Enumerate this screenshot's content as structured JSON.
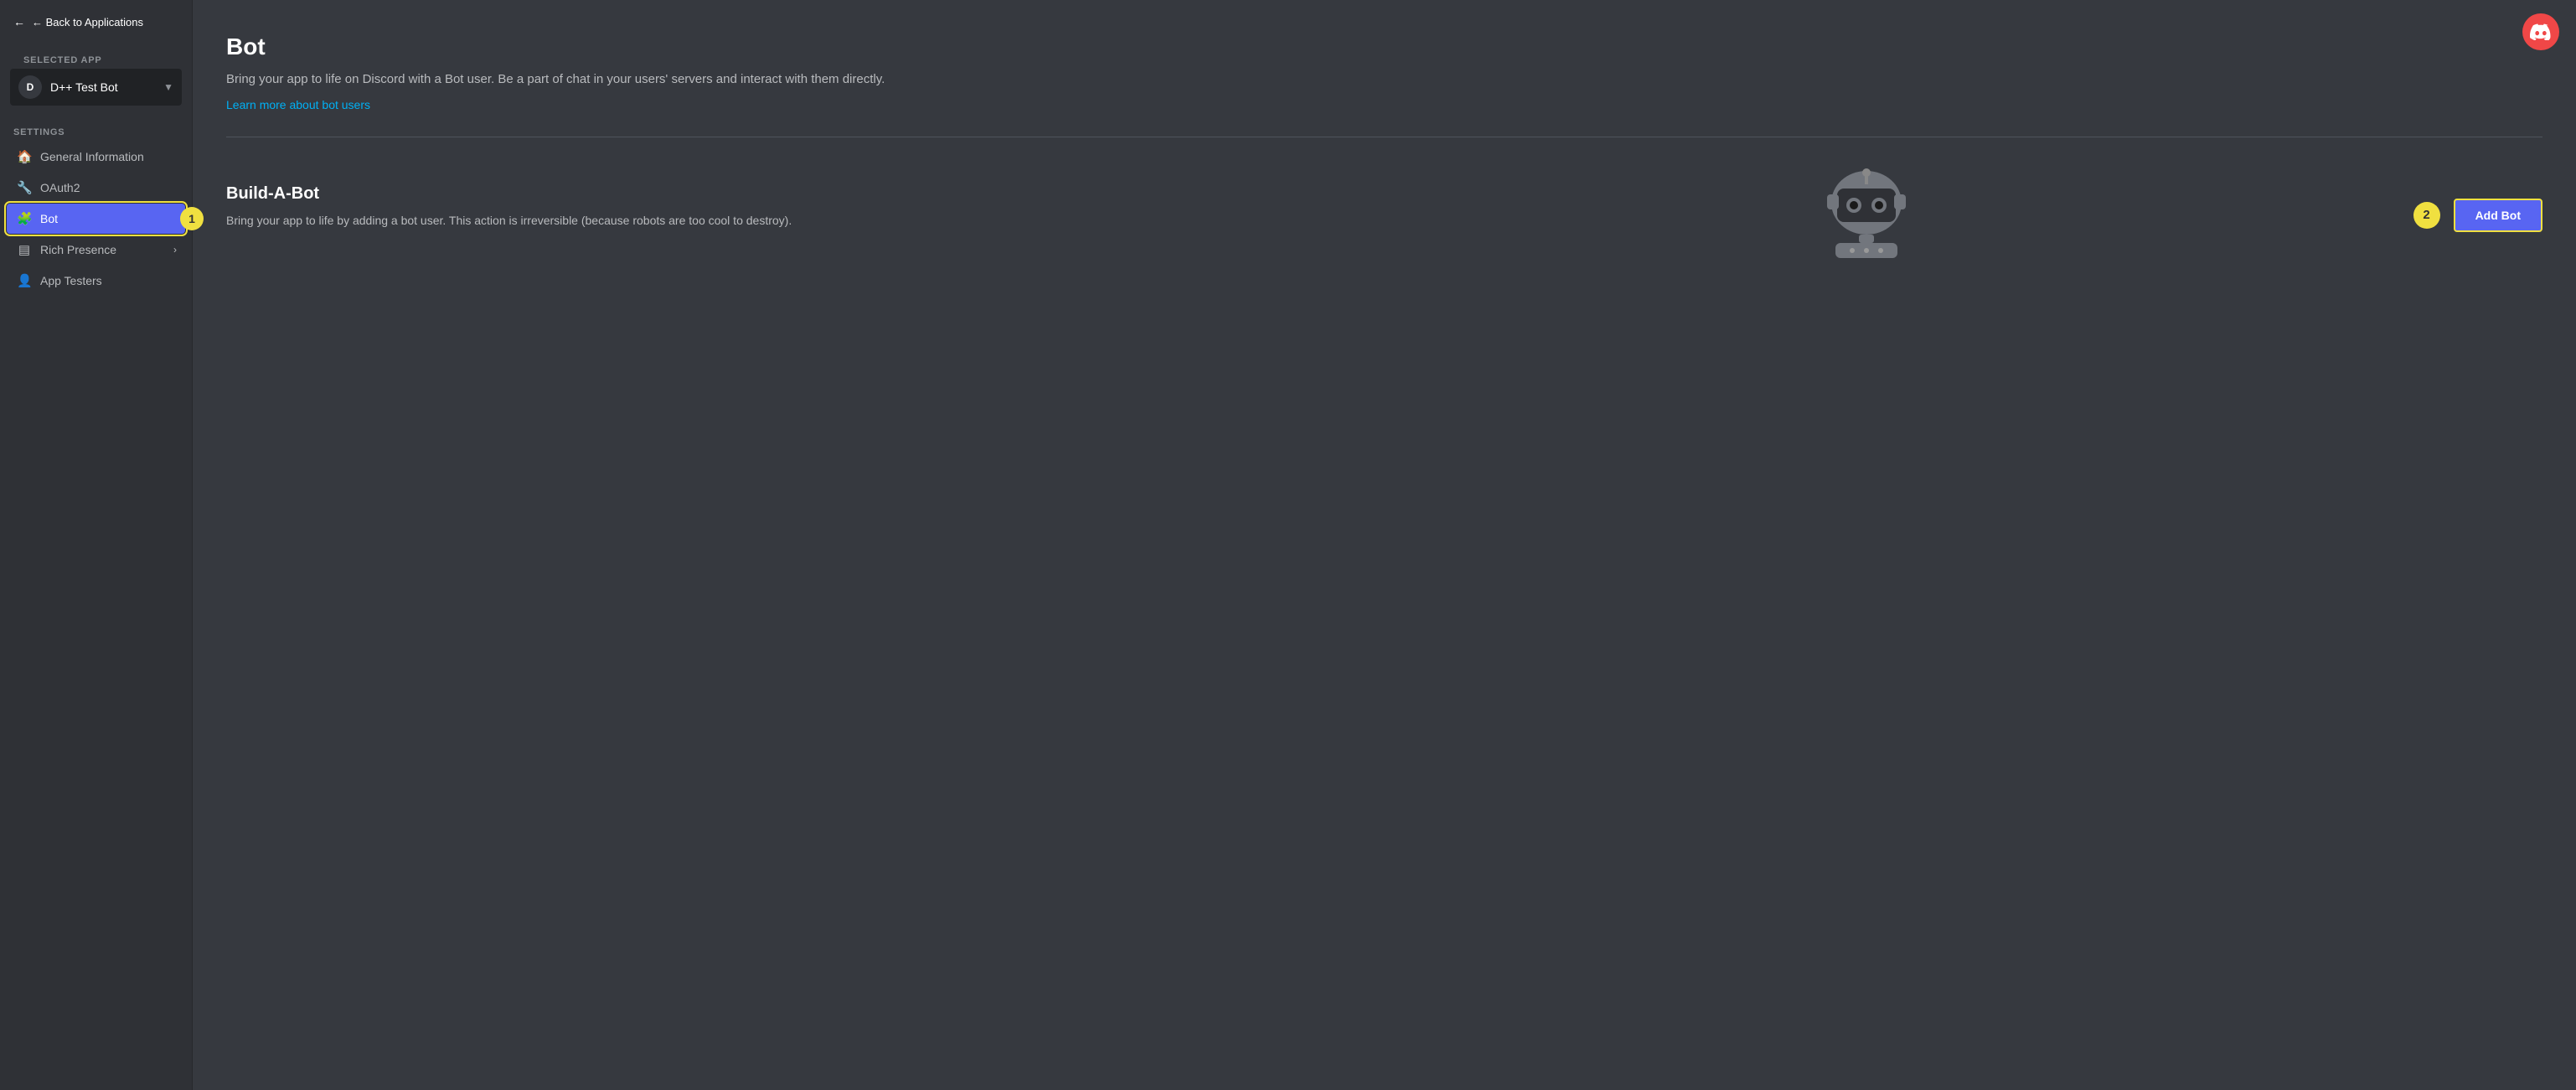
{
  "sidebar": {
    "back_link": "← Back to Applications",
    "selected_app_label": "SELECTED APP",
    "app_name": "D++ Test Bot",
    "settings_label": "SETTINGS",
    "nav_items": [
      {
        "id": "general-information",
        "label": "General Information",
        "icon": "🏠",
        "active": false,
        "chevron": false
      },
      {
        "id": "oauth2",
        "label": "OAuth2",
        "icon": "🔧",
        "active": false,
        "chevron": false
      },
      {
        "id": "bot",
        "label": "Bot",
        "icon": "🧩",
        "active": true,
        "chevron": false
      },
      {
        "id": "rich-presence",
        "label": "Rich Presence",
        "icon": "≡",
        "active": false,
        "chevron": true
      },
      {
        "id": "app-testers",
        "label": "App Testers",
        "icon": "👤",
        "active": false,
        "chevron": false
      }
    ]
  },
  "main": {
    "page_title": "Bot",
    "page_description": "Bring your app to life on Discord with a Bot user. Be a part of chat in your users' servers and interact with them directly.",
    "learn_more_link": "Learn more about bot users",
    "build_a_bot_title": "Build-A-Bot",
    "build_a_bot_description": "Bring your app to life by adding a bot user. This action is irreversible (because robots are too cool to destroy).",
    "add_bot_label": "Add Bot"
  },
  "annotations": {
    "badge_1": "1",
    "badge_2": "2"
  },
  "colors": {
    "active_nav": "#5865f2",
    "accent_blue": "#00b0f4",
    "annotation_yellow": "#f0e040",
    "discord_red": "#f04747"
  }
}
